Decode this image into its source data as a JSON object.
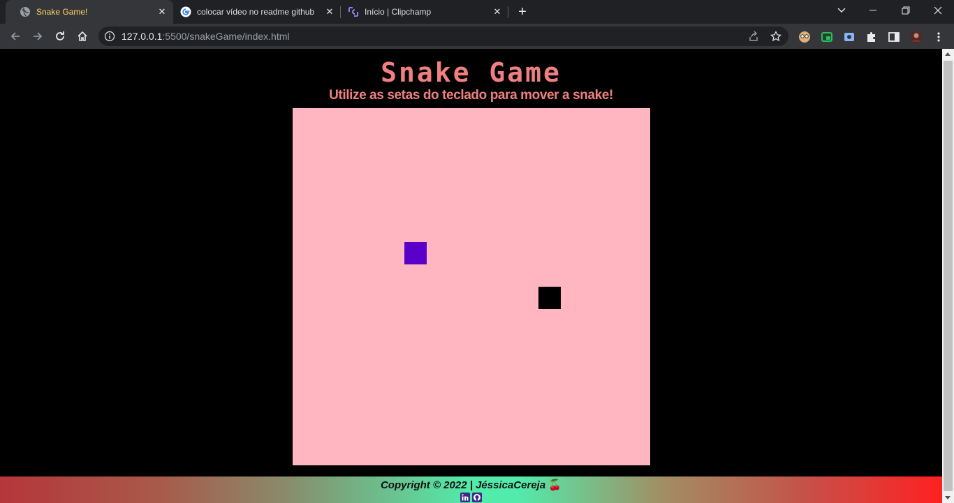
{
  "browser": {
    "tabs": [
      {
        "title": "Snake Game!",
        "active": true,
        "favicon": "globe-icon"
      },
      {
        "title": "colocar vídeo no readme github",
        "active": false,
        "favicon": "google-icon"
      },
      {
        "title": "Início | Clipchamp",
        "active": false,
        "favicon": "clipchamp-icon"
      }
    ],
    "url": {
      "host": "127.0.0.1",
      "rest": ":5500/snakeGame/index.html"
    }
  },
  "page": {
    "title": "Snake Game",
    "subtitle": "Utilize as setas do teclado para mover a snake!",
    "footer": {
      "copyright": "Copyright © 2022 | JéssicaCereja",
      "cherry": "🍒"
    }
  },
  "game": {
    "grid_cells": 16,
    "snake": [
      {
        "col": 11,
        "row": 8
      }
    ],
    "food": {
      "col": 5,
      "row": 6
    },
    "colors": {
      "board": "#ffb6c1",
      "snake": "#000000",
      "food": "#5b00c8",
      "text": "#f08080"
    }
  }
}
